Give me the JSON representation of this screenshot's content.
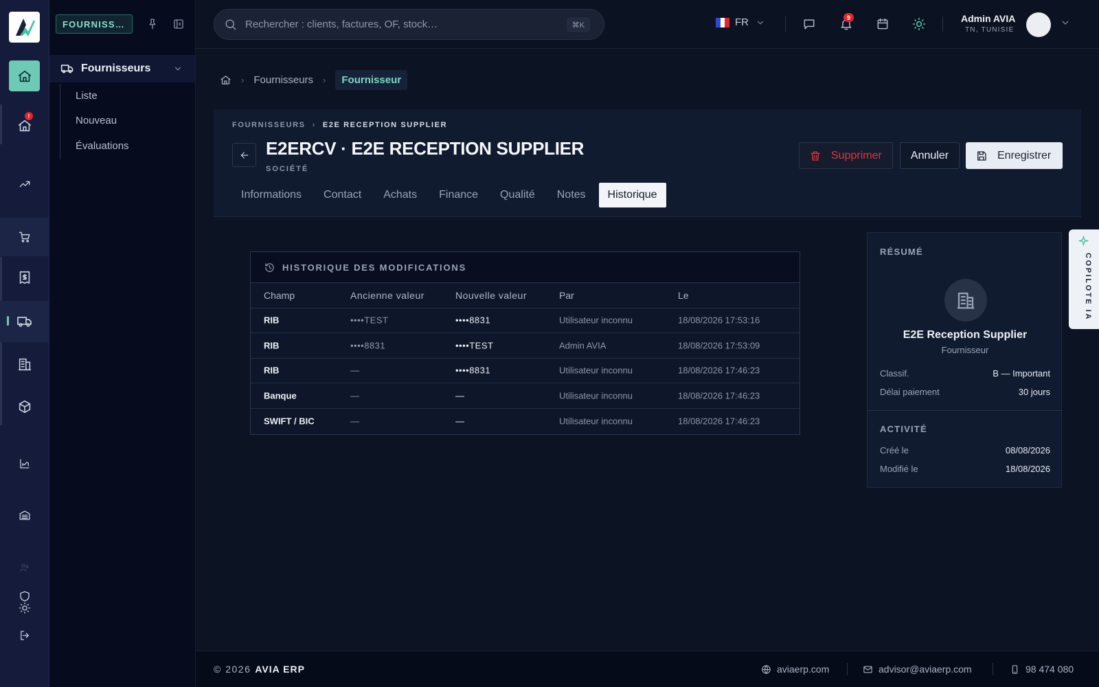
{
  "app": {
    "brand_short": "FOURNISS…",
    "colors": {
      "accent": "#6fcab5",
      "danger": "#e5343a",
      "background": "#0c1322",
      "rail": "#141b3b"
    }
  },
  "rail": {
    "items": [
      "home-icon",
      "home-alert-icon",
      "trending-icon",
      "cart-icon",
      "receipt-icon",
      "truck-icon",
      "building-icon",
      "box-icon",
      "chart-icon",
      "warehouse-icon",
      "users-icon",
      "shield-icon",
      "sun-icon",
      "logout-icon"
    ],
    "alert_badge": "!"
  },
  "sidebar": {
    "group_label": "Fournisseurs",
    "items": [
      "Liste",
      "Nouveau",
      "Évaluations"
    ]
  },
  "topbar": {
    "search_placeholder": "Rechercher : clients, factures, OF, stock…",
    "search_shortcut": "⌘K",
    "language": "FR",
    "notifications_count": "9",
    "user_name": "Admin AVIA",
    "user_location": "TN, TUNISIE"
  },
  "breadcrumb": {
    "parent": "Fournisseurs",
    "current": "Fournisseur"
  },
  "header": {
    "mini_breadcrumb_section": "FOURNISSEURS",
    "mini_breadcrumb_current": "E2E RECEPTION SUPPLIER",
    "title": "E2ERCV · E2E RECEPTION SUPPLIER",
    "subtitle": "SOCIÉTÉ",
    "delete_label": "Supprimer",
    "cancel_label": "Annuler",
    "save_label": "Enregistrer",
    "tabs": [
      "Informations",
      "Contact",
      "Achats",
      "Finance",
      "Qualité",
      "Notes",
      "Historique"
    ],
    "active_tab": "Historique"
  },
  "history": {
    "title": "HISTORIQUE DES MODIFICATIONS",
    "columns": [
      "Champ",
      "Ancienne valeur",
      "Nouvelle valeur",
      "Par",
      "Le"
    ],
    "rows": [
      [
        "RIB",
        "••••TEST",
        "••••8831",
        "Utilisateur inconnu",
        "18/08/2026 17:53:16"
      ],
      [
        "RIB",
        "••••8831",
        "••••TEST",
        "Admin AVIA",
        "18/08/2026 17:53:09"
      ],
      [
        "RIB",
        "—",
        "••••8831",
        "Utilisateur inconnu",
        "18/08/2026 17:46:23"
      ],
      [
        "Banque",
        "—",
        "—",
        "Utilisateur inconnu",
        "18/08/2026 17:46:23"
      ],
      [
        "SWIFT / BIC",
        "—",
        "—",
        "Utilisateur inconnu",
        "18/08/2026 17:46:23"
      ]
    ]
  },
  "summary": {
    "section_title": "RÉSUMÉ",
    "name": "E2E Reception Supplier",
    "role": "Fournisseur",
    "fields": [
      {
        "k": "Classif.",
        "v": "B — Important"
      },
      {
        "k": "Délai paiement",
        "v": "30 jours"
      }
    ],
    "activity_title": "ACTIVITÉ",
    "activity": [
      {
        "k": "Créé le",
        "v": "08/08/2026"
      },
      {
        "k": "Modifié le",
        "v": "18/08/2026"
      }
    ]
  },
  "copilot": {
    "label": "COPILOTE IA"
  },
  "footer": {
    "copyright": "© 2026",
    "brand": "AVIA ERP",
    "website": "aviaerp.com",
    "email": "advisor@aviaerp.com",
    "phone": "98 474 080"
  }
}
